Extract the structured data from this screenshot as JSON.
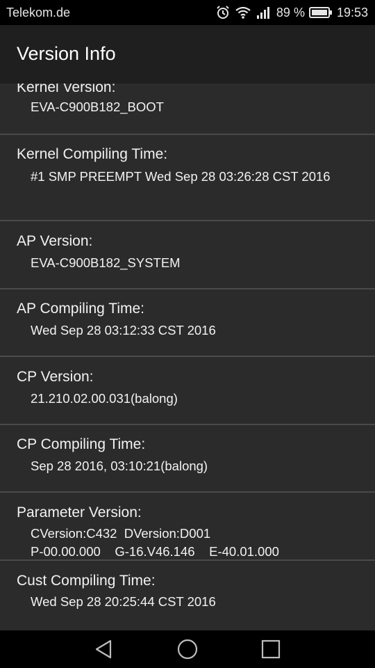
{
  "status_bar": {
    "carrier": "Telekom.de",
    "battery": "89 %",
    "time": "19:53",
    "icons": [
      "alarm-icon",
      "wifi-icon",
      "signal-icon",
      "battery-icon"
    ]
  },
  "app_bar": {
    "title": "Version Info"
  },
  "items": [
    {
      "label": "Kernel Version:",
      "value": "EVA-C900B182_BOOT"
    },
    {
      "label": "Kernel Compiling Time:",
      "value": "#1 SMP PREEMPT Wed Sep 28 03:26:28 CST 2016"
    },
    {
      "label": "AP Version:",
      "value": "EVA-C900B182_SYSTEM"
    },
    {
      "label": "AP Compiling Time:",
      "value": "Wed Sep 28 03:12:33 CST 2016"
    },
    {
      "label": "CP Version:",
      "value": "21.210.02.00.031(balong)"
    },
    {
      "label": "CP Compiling Time:",
      "value": "Sep 28 2016, 03:10:21(balong)"
    },
    {
      "label": "Parameter Version:",
      "value_lines": [
        "CVersion:C432  DVersion:D001",
        "P-00.00.000    G-16.V46.146    E-40.01.000"
      ]
    },
    {
      "label": "Cust Compiling Time:",
      "value": "Wed Sep 28 20:25:44 CST 2016"
    }
  ],
  "nav_bar": {
    "buttons": [
      "back-icon",
      "home-icon",
      "recents-icon"
    ]
  }
}
